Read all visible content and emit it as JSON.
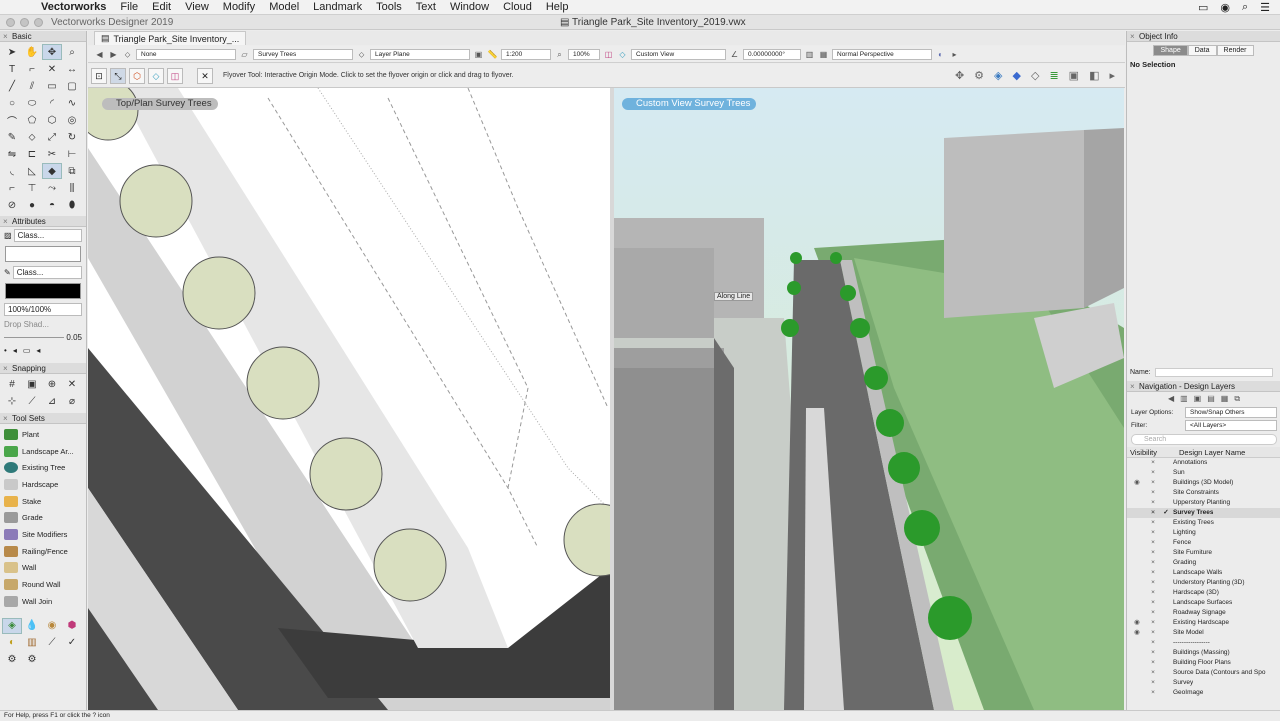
{
  "menubar": {
    "app": "Vectorworks",
    "items": [
      "File",
      "Edit",
      "View",
      "Modify",
      "Model",
      "Landmark",
      "Tools",
      "Text",
      "Window",
      "Cloud",
      "Help"
    ]
  },
  "window": {
    "app_title": "Vectorworks Designer 2019",
    "doc_title": "Triangle Park_Site Inventory_2019.vwx"
  },
  "tab": {
    "label": "Triangle Park_Site Inventory_..."
  },
  "viewbar": {
    "class": "None",
    "layer": "Survey Trees",
    "plane": "Layer Plane",
    "scale": "1:200",
    "zoom": "100%",
    "view": "Custom View",
    "angle": "0.00000000°",
    "render": "Normal Perspective"
  },
  "modebar": {
    "hint": "Flyover Tool: Interactive Origin Mode. Click to set the flyover origin or click and drag to flyover."
  },
  "palettes": {
    "basic": "Basic",
    "attributes": "Attributes",
    "class_label": "Class...",
    "opacity": "100%/100%",
    "drop_shadow": "Drop Shad...",
    "line_weight": "0.05",
    "snapping": "Snapping",
    "tool_sets": "Tool Sets",
    "toolset_items": [
      "Plant",
      "Landscape Ar...",
      "Existing Tree",
      "Hardscape",
      "Stake",
      "Grade",
      "Site Modifiers",
      "Railing/Fence",
      "Wall",
      "Round Wall",
      "Wall Join"
    ],
    "toolset_colors": [
      "#3f8f3a",
      "#4aa64a",
      "#2f7a7a",
      "#c9c9c9",
      "#e8b24a",
      "#9a9a9a",
      "#8c7bb8",
      "#b88a4a",
      "#d9c28a",
      "#c7a86a",
      "#a8a8a8"
    ]
  },
  "viewports": {
    "left_label": "Top/Plan  Survey Trees",
    "right_label": "Custom View  Survey Trees",
    "tooltip": "Along Line"
  },
  "object_info": {
    "title": "Object Info",
    "tabs": [
      "Shape",
      "Data",
      "Render"
    ],
    "selection": "No Selection",
    "name_label": "Name:"
  },
  "navigation": {
    "title": "Navigation - Design Layers",
    "layer_options_label": "Layer Options:",
    "layer_options_value": "Show/Snap Others",
    "filter_label": "Filter:",
    "filter_value": "<All Layers>",
    "search_placeholder": "Search",
    "col_visibility": "Visibility",
    "col_name": "Design Layer Name",
    "layers": [
      {
        "name": "Annotations",
        "vis": "x"
      },
      {
        "name": "Sun",
        "vis": "x"
      },
      {
        "name": "Buildings (3D Model)",
        "vis": "eye"
      },
      {
        "name": "Site Constraints",
        "vis": "x"
      },
      {
        "name": "Upperstory Planting",
        "vis": "x"
      },
      {
        "name": "Survey Trees",
        "vis": "x",
        "active": true
      },
      {
        "name": "Existing Trees",
        "vis": "x"
      },
      {
        "name": "Lighting",
        "vis": "x"
      },
      {
        "name": "Fence",
        "vis": "x"
      },
      {
        "name": "Site Furniture",
        "vis": "x"
      },
      {
        "name": "Grading",
        "vis": "x"
      },
      {
        "name": "Landscape Walls",
        "vis": "x"
      },
      {
        "name": "Understory Planting (3D)",
        "vis": "x"
      },
      {
        "name": "Hardscape (3D)",
        "vis": "x"
      },
      {
        "name": "Landscape Surfaces",
        "vis": "x"
      },
      {
        "name": "Roadway Signage",
        "vis": "x"
      },
      {
        "name": "Existing Hardscape",
        "vis": "eye"
      },
      {
        "name": "Site Model",
        "vis": "eye"
      },
      {
        "name": "-----------------",
        "vis": "x"
      },
      {
        "name": "Buildings (Massing)",
        "vis": "x"
      },
      {
        "name": "Building Floor Plans",
        "vis": "x"
      },
      {
        "name": "Source Data (Contours and Spo",
        "vis": "x"
      },
      {
        "name": "Survey",
        "vis": "x"
      },
      {
        "name": "GeoImage",
        "vis": "x"
      }
    ]
  },
  "status": {
    "text": "For Help, press F1 or click the ? icon"
  }
}
